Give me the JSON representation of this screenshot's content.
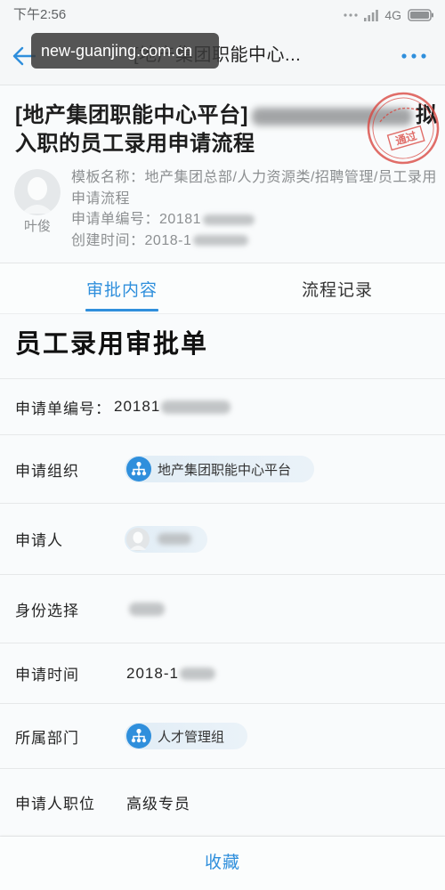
{
  "status_bar": {
    "time": "下午2:56",
    "network": "4G"
  },
  "nav": {
    "title": "[地产集团职能中心...",
    "back_icon": "back-arrow-icon",
    "more_icon": "more-dots-icon"
  },
  "watermark": {
    "text": "new-guanjing.com.cn"
  },
  "header": {
    "title_prefix": "[地产集团职能中心平台]",
    "title_suffix": "拟",
    "title_line2": "入职的员工录用申请流程",
    "stamp_text": "通过"
  },
  "applicant": {
    "name": "叶俊",
    "avatar_icon": "avatar-placeholder-icon"
  },
  "meta": {
    "template_label": "模板名称：",
    "template_value": "地产集团总部/人力资源类/招聘管理/员工录用申请流程",
    "number_label": "申请单编号：",
    "number_value": "20181",
    "created_label": "创建时间：",
    "created_value": "2018-1"
  },
  "tabs": [
    {
      "label": "审批内容",
      "active": true
    },
    {
      "label": "流程记录",
      "active": false
    }
  ],
  "form": {
    "title": "员工录用审批单",
    "rows": [
      {
        "label": "申请单编号：",
        "value": "20181"
      },
      {
        "label": "申请组织",
        "value": "地产集团职能中心平台",
        "icon": "org-icon"
      },
      {
        "label": "申请人"
      },
      {
        "label": "身份选择"
      },
      {
        "label": "申请时间",
        "value": "2018-1"
      },
      {
        "label": "所属部门",
        "value": "人才管理组",
        "icon": "org-icon"
      },
      {
        "label": "申请人职位",
        "value": "高级专员"
      }
    ]
  },
  "footer": {
    "favorite_label": "收藏"
  },
  "colors": {
    "accent": "#2f8fdc",
    "stamp": "#d9463f",
    "text": "#222222",
    "muted": "#8c8f91",
    "chip_bg": "#e1edf6"
  }
}
